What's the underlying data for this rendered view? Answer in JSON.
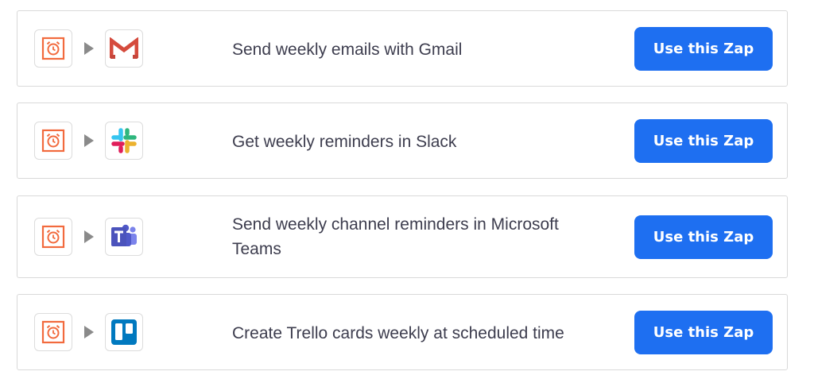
{
  "button_label": "Use this Zap",
  "brand_colors": {
    "button": "#1e6ff1",
    "schedule": "#f26a3d",
    "gmail": "#d54b3d",
    "teams": "#5059c9",
    "trello": "#0079bf"
  },
  "zaps": [
    {
      "trigger_icon": "alarm-clock-icon",
      "action_icon": "gmail-icon",
      "title": "Send weekly emails with Gmail"
    },
    {
      "trigger_icon": "alarm-clock-icon",
      "action_icon": "slack-icon",
      "title": "Get weekly reminders in Slack"
    },
    {
      "trigger_icon": "alarm-clock-icon",
      "action_icon": "microsoft-teams-icon",
      "title": "Send weekly channel reminders in Microsoft Teams"
    },
    {
      "trigger_icon": "alarm-clock-icon",
      "action_icon": "trello-icon",
      "title": "Create Trello cards weekly at scheduled time"
    }
  ]
}
